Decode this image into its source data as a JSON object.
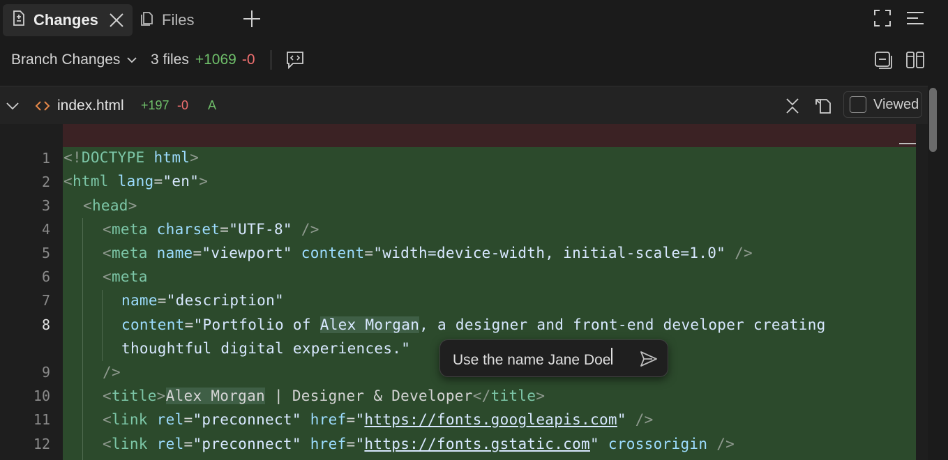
{
  "tabs": [
    {
      "label": "Changes",
      "icon": "document-diff-icon",
      "active": true
    },
    {
      "label": "Files",
      "icon": "files-icon",
      "active": false
    }
  ],
  "toolbar": {
    "scope_label": "Branch Changes",
    "files_count": "3 files",
    "additions": "+1069",
    "deletions": "-0"
  },
  "file": {
    "name": "index.html",
    "additions": "+197",
    "deletions": "-0",
    "status": "A",
    "viewed_label": "Viewed"
  },
  "line_numbers": [
    "1",
    "2",
    "3",
    "4",
    "5",
    "6",
    "7",
    "8",
    "",
    "9",
    "10",
    "11",
    "12"
  ],
  "code": {
    "l1": {
      "a": "<!",
      "b": "DOCTYPE",
      "c": " html",
      "d": ">"
    },
    "l2": {
      "a": "<",
      "b": "html",
      "c": " lang",
      "d": "=",
      "e": "\"en\"",
      "f": ">"
    },
    "l3": {
      "a": "<",
      "b": "head",
      "c": ">"
    },
    "l4": {
      "a": "<",
      "b": "meta",
      "c": " charset",
      "d": "=",
      "e": "\"UTF-8\"",
      "f": " />"
    },
    "l5": {
      "a": "<",
      "b": "meta",
      "c": " name",
      "d": "=",
      "e": "\"viewport\"",
      "f": " content",
      "g": "=",
      "h": "\"width=device-width, initial-scale=1.0\"",
      "i": " />"
    },
    "l6": {
      "a": "<",
      "b": "meta"
    },
    "l7": {
      "a": "name",
      "b": "=",
      "c": "\"description\""
    },
    "l8": {
      "a": "content",
      "b": "=",
      "c": "\"Portfolio of ",
      "d": "Alex Morgan",
      "e": ", a designer and front-end developer creating"
    },
    "l8b": {
      "a": "thoughtful digital experiences.\""
    },
    "l9": {
      "a": "/>"
    },
    "l10": {
      "a": "<",
      "b": "title",
      "c": ">",
      "d": "Alex Morgan",
      "e": " | Designer & Developer",
      "f": "</",
      "g": "title",
      "h": ">"
    },
    "l11": {
      "a": "<",
      "b": "link",
      "c": " rel",
      "d": "=",
      "e": "\"preconnect\"",
      "f": " href",
      "g": "=",
      "h": "\"",
      "i": "https://fonts.googleapis.com",
      "j": "\"",
      "k": " />"
    },
    "l12": {
      "a": "<",
      "b": "link",
      "c": " rel",
      "d": "=",
      "e": "\"preconnect\"",
      "f": " href",
      "g": "=",
      "h": "\"",
      "i": "https://fonts.gstatic.com",
      "j": "\"",
      "k": " crossorigin",
      "l": " />"
    }
  },
  "comment_popup": {
    "text": "Use the name Jane Doe"
  },
  "colors": {
    "added_bg": "#2c4a2c",
    "deleted_bg": "#3b2224",
    "additions": "#6fbf6a",
    "deletions": "#f07070"
  }
}
